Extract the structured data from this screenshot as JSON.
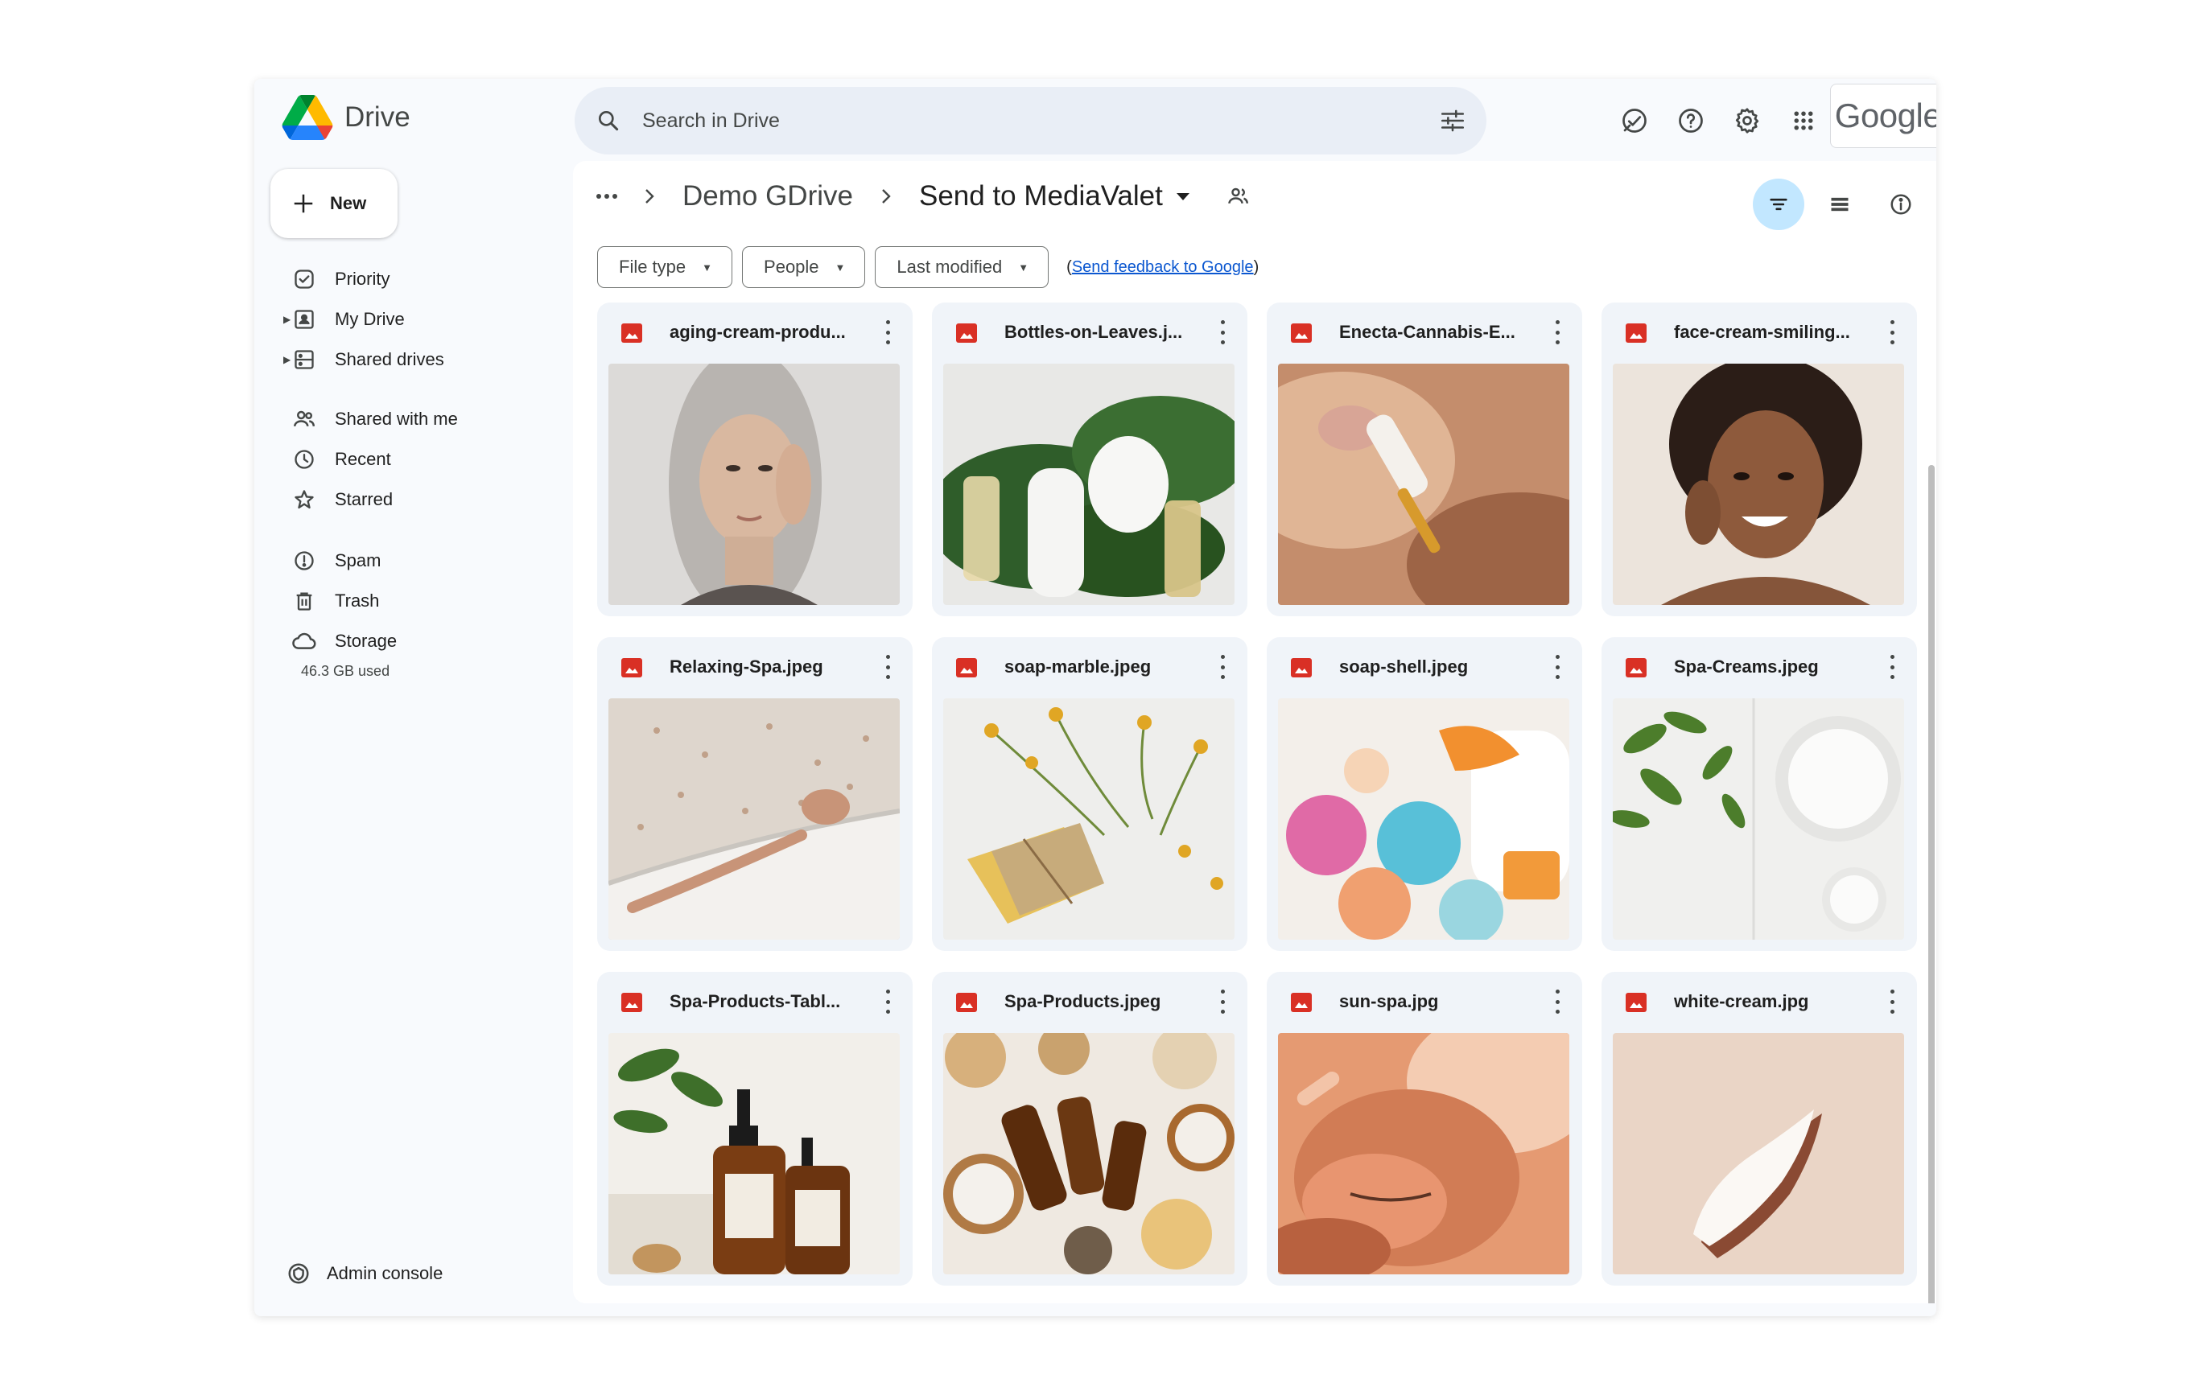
{
  "app": {
    "name": "Drive"
  },
  "search": {
    "placeholder": "Search in Drive"
  },
  "header": {
    "google_logo_text": "Google"
  },
  "sidebar": {
    "new_label": "New",
    "items": [
      {
        "label": "Priority",
        "icon": "priority-icon"
      },
      {
        "label": "My Drive",
        "icon": "my-drive-icon"
      },
      {
        "label": "Shared drives",
        "icon": "shared-drives-icon"
      },
      {
        "label": "Shared with me",
        "icon": "people-icon"
      },
      {
        "label": "Recent",
        "icon": "clock-icon"
      },
      {
        "label": "Starred",
        "icon": "star-icon"
      },
      {
        "label": "Spam",
        "icon": "spam-icon"
      },
      {
        "label": "Trash",
        "icon": "trash-icon"
      },
      {
        "label": "Storage",
        "icon": "cloud-icon"
      }
    ],
    "storage_used": "46.3 GB used",
    "admin_label": "Admin console"
  },
  "breadcrumb": {
    "root": "Demo GDrive",
    "current": "Send to MediaValet"
  },
  "filters": {
    "file_type": "File type",
    "people": "People",
    "last_modified": "Last modified",
    "feedback_prefix": "(",
    "feedback_link": "Send feedback to Google",
    "feedback_suffix": ")"
  },
  "files": [
    {
      "name": "aging-cream-produ...",
      "thumb": "woman-gray-hair"
    },
    {
      "name": "Bottles-on-Leaves.j...",
      "thumb": "bottles-leaves"
    },
    {
      "name": "Enecta-Cannabis-E...",
      "thumb": "dropper"
    },
    {
      "name": "face-cream-smiling...",
      "thumb": "smiling-woman"
    },
    {
      "name": "Relaxing-Spa.jpeg",
      "thumb": "bath"
    },
    {
      "name": "soap-marble.jpeg",
      "thumb": "soap-flowers"
    },
    {
      "name": "soap-shell.jpeg",
      "thumb": "bath-bombs"
    },
    {
      "name": "Spa-Creams.jpeg",
      "thumb": "creams-leaves"
    },
    {
      "name": "Spa-Products-Tabl...",
      "thumb": "amber-bottles"
    },
    {
      "name": "Spa-Products.jpeg",
      "thumb": "spa-flatlay"
    },
    {
      "name": "sun-spa.jpg",
      "thumb": "sun-spa"
    },
    {
      "name": "white-cream.jpg",
      "thumb": "cream-smear"
    }
  ],
  "colors": {
    "accent": "#0b57d0",
    "active_view": "#c2e7ff",
    "image_file_icon": "#d93025"
  }
}
